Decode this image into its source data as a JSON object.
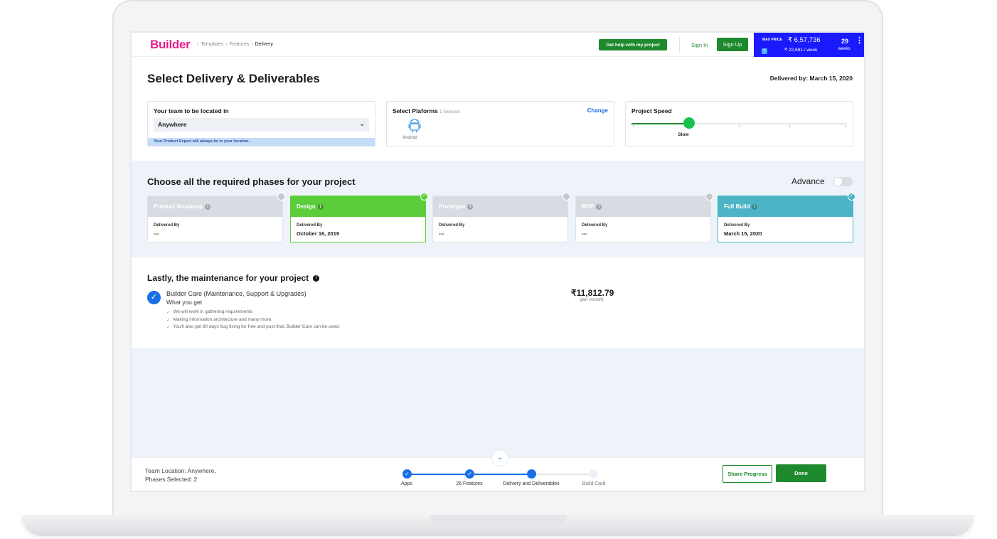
{
  "header": {
    "logo": "Builder",
    "breadcrumb": [
      "Templates",
      "Features",
      "Delivery"
    ],
    "help_label": "Get help with my project",
    "signin_label": "Sign In",
    "signup_label": "Sign Up",
    "price": {
      "max_price_label": "MAX PRICE",
      "help_mark": "?",
      "total": "₹ 6,57,736",
      "weekly": "₹ 22,681 / week",
      "weeks": "29",
      "weeks_label": "weeks"
    }
  },
  "page": {
    "title": "Select Delivery & Deliverables",
    "delivered_by": "Delivered by: March 15, 2020"
  },
  "location": {
    "label": "Your team to be located in",
    "value": "Anywhere",
    "note": "Your Product Expert will always be in your location."
  },
  "platforms": {
    "label": "Select Plaforms",
    "selected_count": "1 Selected",
    "change_label": "Change",
    "items": [
      "Android"
    ]
  },
  "speed": {
    "label": "Project Speed",
    "value": "Slow",
    "level": 0.25
  },
  "phases": {
    "title": "Choose all the required phases for your project",
    "advance_label": "Advance",
    "delivered_label": "Delivered By",
    "items": [
      {
        "name": "Product Roadmap",
        "date": "---"
      },
      {
        "name": "Design",
        "date": "October 16, 2019"
      },
      {
        "name": "Prototype",
        "date": "---"
      },
      {
        "name": "MVP",
        "date": "---"
      },
      {
        "name": "Full Build",
        "date": "March 15, 2020"
      }
    ]
  },
  "maintenance": {
    "title": "Lastly, the maintenance for your project",
    "plan": "Builder Care (Maintenance, Support & Upgrades)",
    "what_you_get": "What you get",
    "bullets": [
      "We will work in gathering requirements",
      "Making information architecture and many more.",
      "You'll also get 90 days bug fixing for free and post that, Builder Care can be used."
    ],
    "price": "₹11,812.79",
    "per": "(per month)"
  },
  "footer": {
    "team_location": "Team Location: Anywhere,",
    "phases_selected": "Phases Selected: 2",
    "steps": [
      "Apps",
      "26 Features",
      "Delivery and Deliverables",
      "Build Card"
    ],
    "share_label": "Share Progress",
    "done_label": "Done"
  },
  "colors": {
    "brand": "#e61e8c",
    "primary_green": "#1e8a2e",
    "accent_blue": "#1a6fe6",
    "price_box": "#1a1aff",
    "design_phase": "#5bcd3a",
    "full_build_phase": "#4db3c6"
  }
}
